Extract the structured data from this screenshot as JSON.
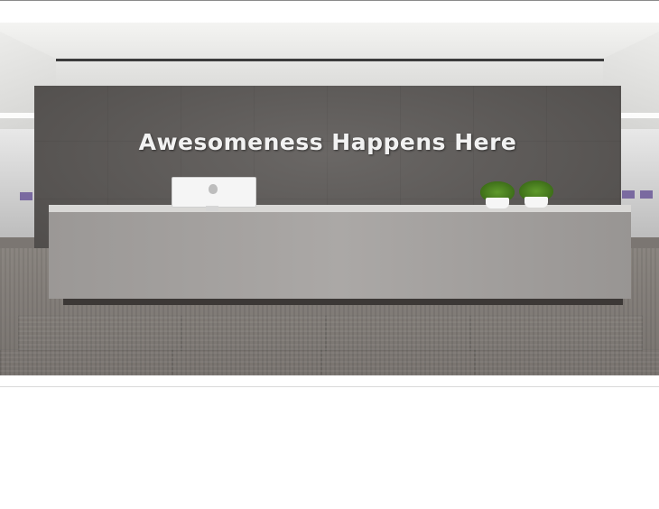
{
  "photo": {
    "sign_text": "Awesomeness Happens Here",
    "alt": "",
    "colors": {
      "wall": "#5c5957",
      "desk": "#a3a09e",
      "floor": "#817c78",
      "ceiling": "#eaeaea",
      "sign": "#f2f2f2",
      "plant": "#4d8623"
    },
    "icons": [
      "apple-logo-icon"
    ]
  }
}
